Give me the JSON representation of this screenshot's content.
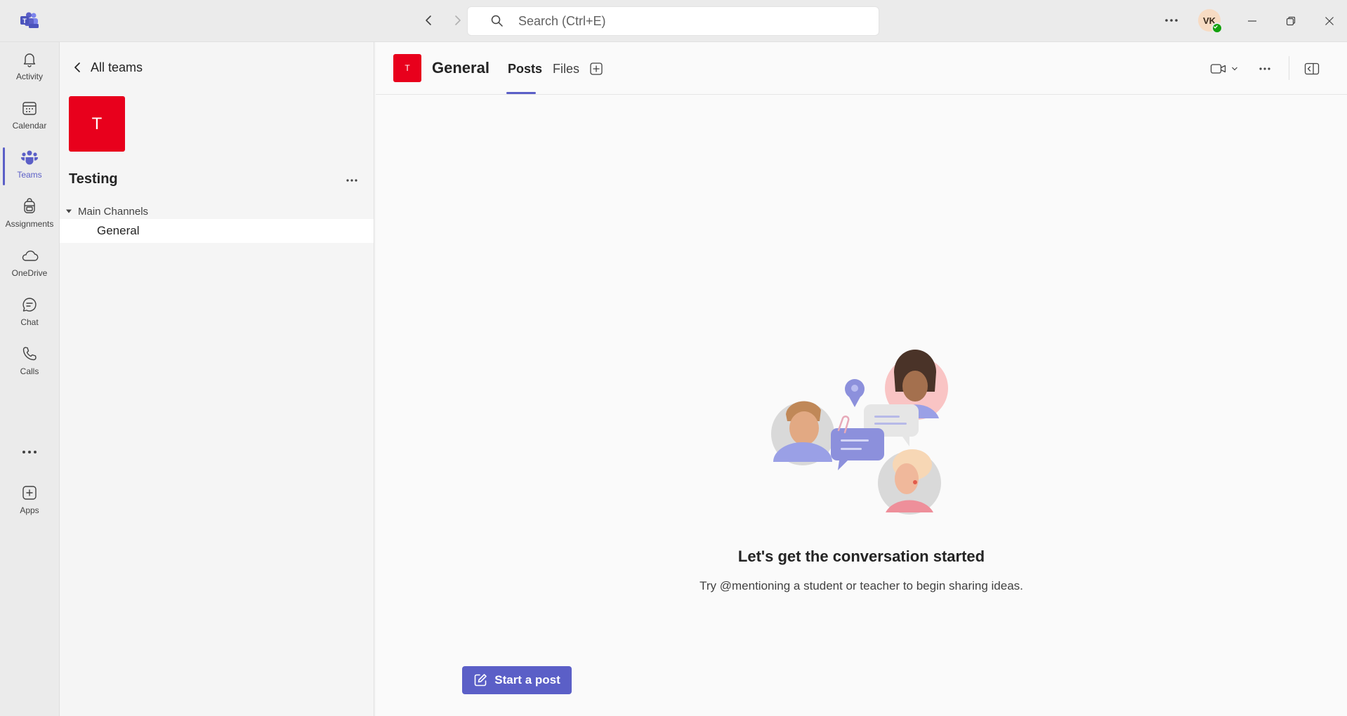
{
  "titlebar": {
    "search_placeholder": "Search (Ctrl+E)",
    "avatar_initials": "VK",
    "icons": [
      "teams-new-logo-icon",
      "back-arrow-icon",
      "forward-arrow-icon",
      "search-icon",
      "more-options-icon",
      "minimize-icon",
      "restore-icon",
      "close-icon"
    ]
  },
  "rail": {
    "items": [
      {
        "label": "Activity",
        "icon": "bell-icon"
      },
      {
        "label": "Calendar",
        "icon": "calendar-icon"
      },
      {
        "label": "Teams",
        "icon": "teams-icon",
        "active": true
      },
      {
        "label": "Assignments",
        "icon": "backpack-icon"
      },
      {
        "label": "OneDrive",
        "icon": "cloud-icon"
      },
      {
        "label": "Chat",
        "icon": "chat-icon"
      },
      {
        "label": "Calls",
        "icon": "phone-icon"
      },
      {
        "label": "Apps",
        "icon": "add-square-icon"
      }
    ]
  },
  "team_pane": {
    "back_label": "All teams",
    "team_initial": "T",
    "team_name": "Testing",
    "group_label": "Main Channels",
    "channels": [
      {
        "label": "General",
        "selected": true
      }
    ]
  },
  "channel": {
    "initial": "T",
    "title": "General",
    "tabs": [
      {
        "label": "Posts",
        "active": true
      },
      {
        "label": "Files",
        "active": false
      }
    ]
  },
  "empty_state": {
    "title": "Let's get the conversation started",
    "subtitle": "Try @mentioning a student or teacher to begin sharing ideas."
  },
  "actions": {
    "start_post_label": "Start a post"
  },
  "colors": {
    "brand": "#5b5fc7",
    "team_tile": "#e8001c",
    "presence_available": "#13a10e"
  }
}
